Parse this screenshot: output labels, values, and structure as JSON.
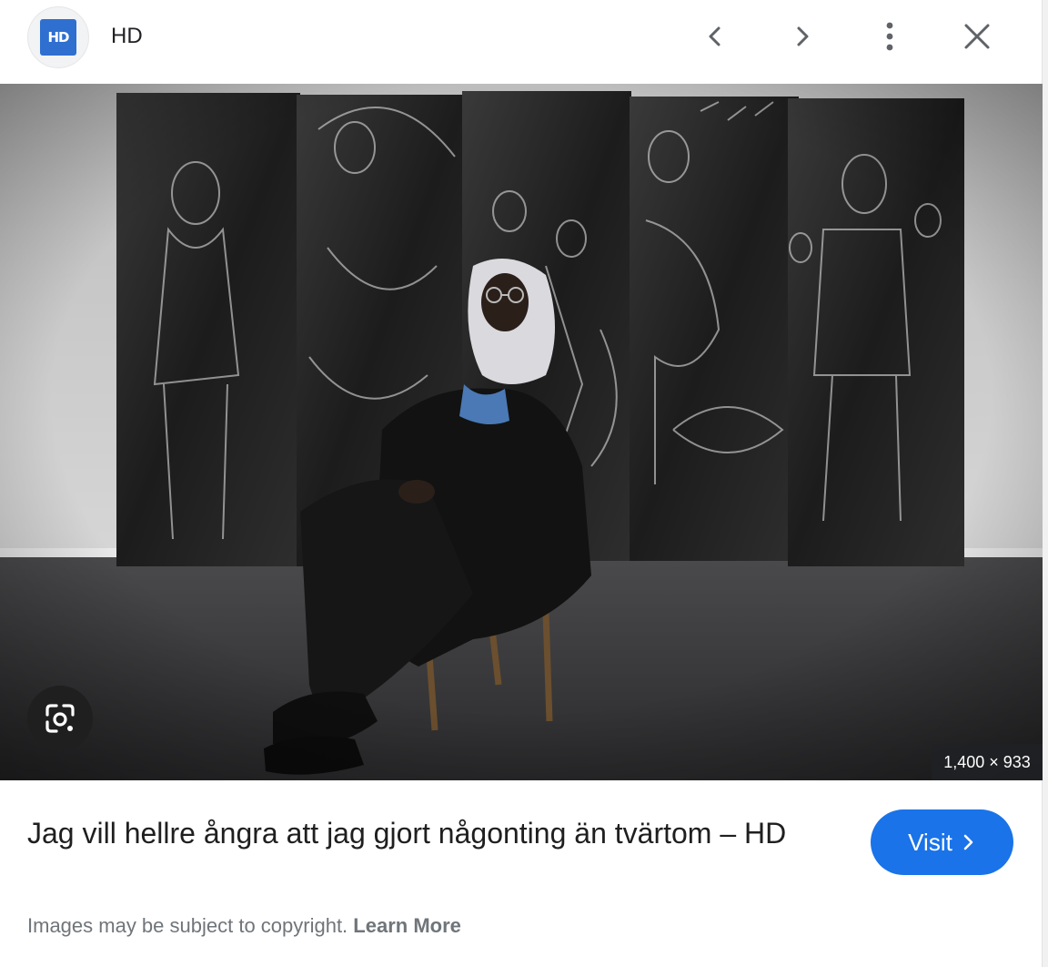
{
  "header": {
    "logo_text": "HD",
    "site_name": "HD"
  },
  "image": {
    "dimensions": "1,400 × 933"
  },
  "result": {
    "title": "Jag vill hellre ångra att jag gjort någonting än tvärtom – HD",
    "visit_label": "Visit"
  },
  "footer": {
    "copyright_text": "Images may be subject to copyright.",
    "learn_more": "Learn More"
  },
  "colors": {
    "accent": "#1a73e8",
    "logo_blue": "#2f6fcf",
    "muted_text": "#70757a"
  },
  "icons": [
    "chevron-left-icon",
    "chevron-right-icon",
    "more-vert-icon",
    "close-icon",
    "google-lens-icon",
    "chevron-right-small-icon"
  ]
}
